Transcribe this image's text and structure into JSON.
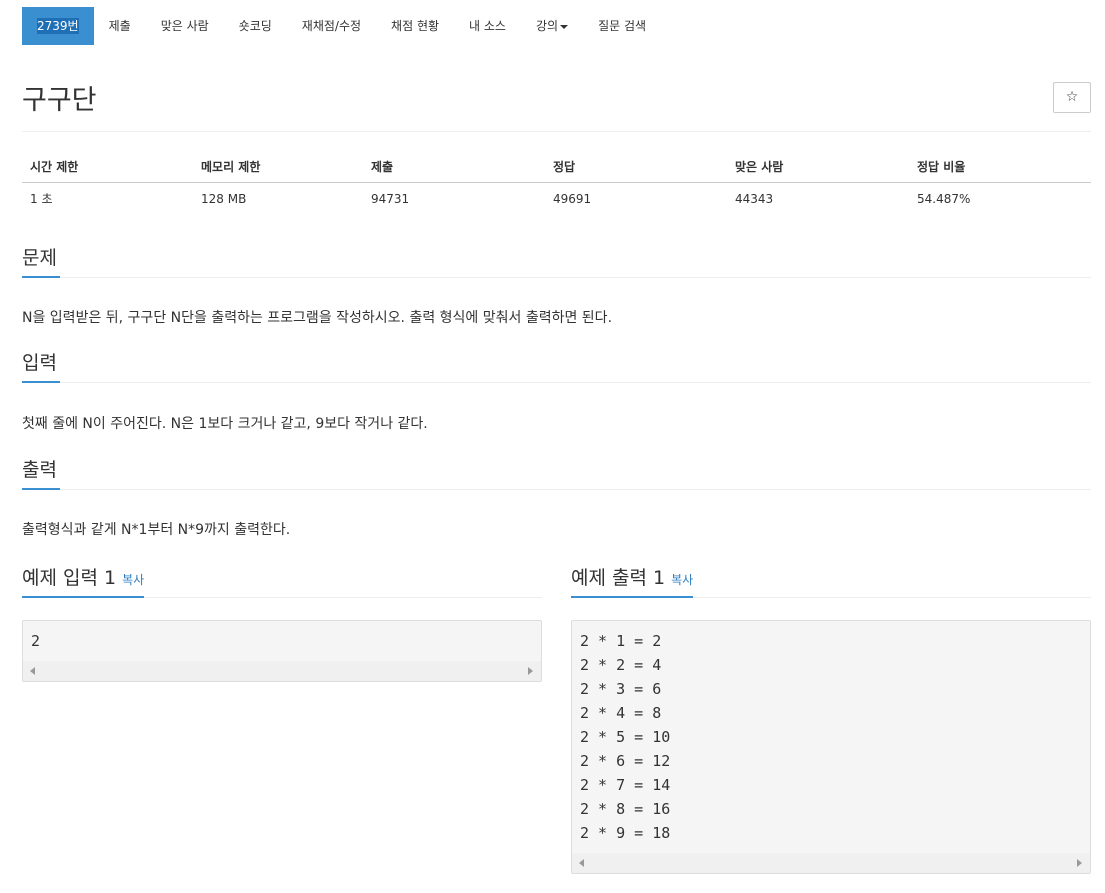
{
  "tabs": {
    "problem_number": "2739번",
    "submit": "제출",
    "solvers": "맞은 사람",
    "shortest": "숏코딩",
    "rejudge": "재채점/수정",
    "status": "채점 현황",
    "my_source": "내 소스",
    "lecture": "강의",
    "qna": "질문 검색"
  },
  "problem": {
    "title": "구구단",
    "star": "☆"
  },
  "stats": {
    "headers": [
      "시간 제한",
      "메모리 제한",
      "제출",
      "정답",
      "맞은 사람",
      "정답 비율"
    ],
    "values": [
      "1 초",
      "128 MB",
      "94731",
      "49691",
      "44343",
      "54.487%"
    ]
  },
  "sections": {
    "description_title": "문제",
    "description": "N을 입력받은 뒤, 구구단 N단을 출력하는 프로그램을 작성하시오. 출력 형식에 맞춰서 출력하면 된다.",
    "input_title": "입력",
    "input": "첫째 줄에 N이 주어진다. N은 1보다 크거나 같고, 9보다 작거나 같다.",
    "output_title": "출력",
    "output": "출력형식과 같게 N*1부터 N*9까지 출력한다."
  },
  "examples": {
    "input_title": "예제 입력 1",
    "output_title": "예제 출력 1",
    "copy_label": "복사",
    "input_lines": [
      "2"
    ],
    "output_lines": [
      "2 * 1 = 2",
      "2 * 2 = 4",
      "2 * 3 = 6",
      "2 * 4 = 8",
      "2 * 5 = 10",
      "2 * 6 = 12",
      "2 * 7 = 14",
      "2 * 8 = 16",
      "2 * 9 = 18"
    ]
  },
  "colors": {
    "accent": "#3a8fd1",
    "link": "#2b7dc2"
  }
}
